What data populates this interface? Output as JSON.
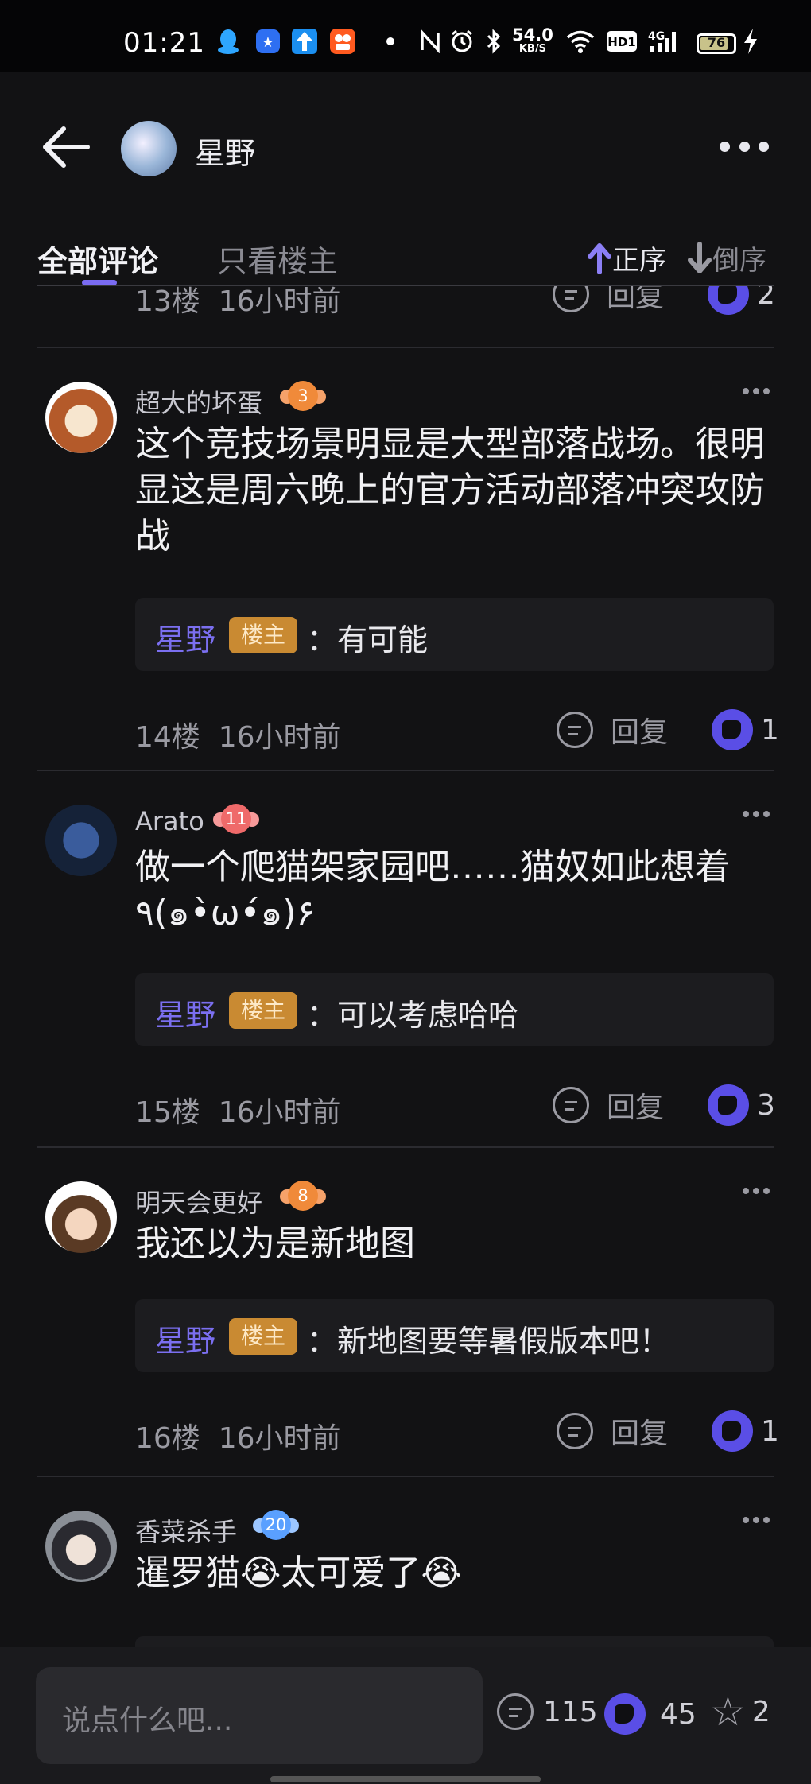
{
  "status_bar": {
    "time": "01:21",
    "network_speed_top": "54.0",
    "network_speed_unit": "KB/S",
    "hd_label": "HD1",
    "signal_label": "4G",
    "battery": "76",
    "icons": [
      "qq-icon",
      "app-blue-icon",
      "app-arrow-icon",
      "kuaishou-icon",
      "dot-icon",
      "nfc-icon",
      "alarm-icon",
      "bluetooth-icon",
      "wifi-icon",
      "hd-icon",
      "signal-icon",
      "battery-icon",
      "charging-icon"
    ]
  },
  "header": {
    "owner_name": "星野",
    "tabs": [
      {
        "label": "全部评论",
        "active": true
      },
      {
        "label": "只看楼主",
        "active": false
      }
    ],
    "sort_asc": "正序",
    "sort_desc": "倒序"
  },
  "partial_top": {
    "floor": "13楼",
    "time": "16小时前",
    "reply": "回复",
    "likes": "2"
  },
  "comments": [
    {
      "username": "超大的坏蛋",
      "level": "3",
      "text": "这个竞技场景明显是大型部落战场。很明显这是周六晚上的官方活动部落冲突攻防战",
      "reply": {
        "name": "星野",
        "tag": "楼主",
        "text": "：有可能"
      },
      "floor": "14楼",
      "time": "16小时前",
      "reply_label": "回复",
      "likes": "1"
    },
    {
      "username": "Arato",
      "level": "11",
      "text": "做一个爬猫架家园吧……猫奴如此想着٩(๑•̀ω•́๑)۶",
      "reply": {
        "name": "星野",
        "tag": "楼主",
        "text": "：可以考虑哈哈"
      },
      "floor": "15楼",
      "time": "16小时前",
      "reply_label": "回复",
      "likes": "3"
    },
    {
      "username": "明天会更好",
      "level": "8",
      "text": "我还以为是新地图",
      "reply": {
        "name": "星野",
        "tag": "楼主",
        "text": "：新地图要等暑假版本吧！"
      },
      "floor": "16楼",
      "time": "16小时前",
      "reply_label": "回复",
      "likes": "1"
    },
    {
      "username": "香菜杀手",
      "level": "20",
      "text": "暹罗猫😭太可爱了😭"
    }
  ],
  "bottom_bar": {
    "placeholder": "说点什么吧...",
    "comment_count": "115",
    "like_count": "45",
    "star_count": "2"
  },
  "colors": {
    "background": "#121214",
    "accent_purple": "#7a6bf2",
    "owner_tag": "#c98a32",
    "level_orange": "#f08a3a",
    "level_pink": "#ef6a6a",
    "level_blue": "#5aa0ff"
  }
}
